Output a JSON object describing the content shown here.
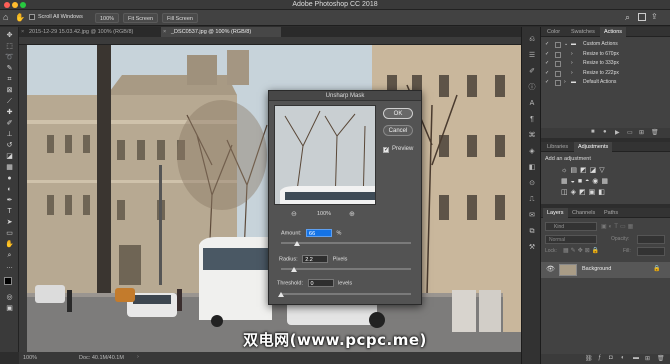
{
  "app": {
    "title": "Adobe Photoshop CC 2018"
  },
  "options_bar": {
    "scroll_all_windows": "Scroll All Windows",
    "zoom_value": "100%",
    "fit_screen": "Fit Screen",
    "fill_screen": "Fill Screen"
  },
  "doc_tabs": [
    {
      "label": "2015-12-29 15.03.42.jpg @ 100% (RGB/8)",
      "active": false
    },
    {
      "label": "_DSC0537.jpg @ 100% (RGB/8)",
      "active": true
    }
  ],
  "status": {
    "zoom": "100%",
    "doc_size": "Doc: 40.1M/40.1M"
  },
  "actions_panel": {
    "tabs": [
      "Color",
      "Swatches",
      "Actions"
    ],
    "items": [
      {
        "label": "Custom Actions",
        "kind": "set"
      },
      {
        "label": "Resize to 670px",
        "kind": "action"
      },
      {
        "label": "Resize to 333px",
        "kind": "action"
      },
      {
        "label": "Resize to 222px",
        "kind": "action"
      },
      {
        "label": "Default Actions",
        "kind": "set"
      }
    ]
  },
  "adjustments_panel": {
    "tabs": [
      "Libraries",
      "Adjustments"
    ],
    "heading": "Add an adjustment"
  },
  "layers_panel": {
    "tabs": [
      "Layers",
      "Channels",
      "Paths"
    ],
    "filter_placeholder": "Kind",
    "blend_mode": "Normal",
    "opacity_label": "Opacity:",
    "lock_label": "Lock:",
    "fill_label": "Fill:",
    "layer_name": "Background"
  },
  "unsharp_mask": {
    "title": "Unsharp Mask",
    "ok": "OK",
    "cancel": "Cancel",
    "preview_label": "Preview",
    "preview_checked": true,
    "zoom": "100%",
    "amount_label": "Amount:",
    "amount_value": "66",
    "amount_unit": "%",
    "amount_level": 0.12,
    "radius_label": "Radius:",
    "radius_value": "2.2",
    "radius_unit": "Pixels",
    "radius_level": 0.1,
    "threshold_label": "Threshold:",
    "threshold_value": "0",
    "threshold_unit": "levels",
    "threshold_level": 0.0
  },
  "watermark": "双电网(www.pcpc.me)",
  "colors": {
    "accent": "#1473e6",
    "panel_bg": "#424242",
    "dialog_bg": "#535353"
  }
}
